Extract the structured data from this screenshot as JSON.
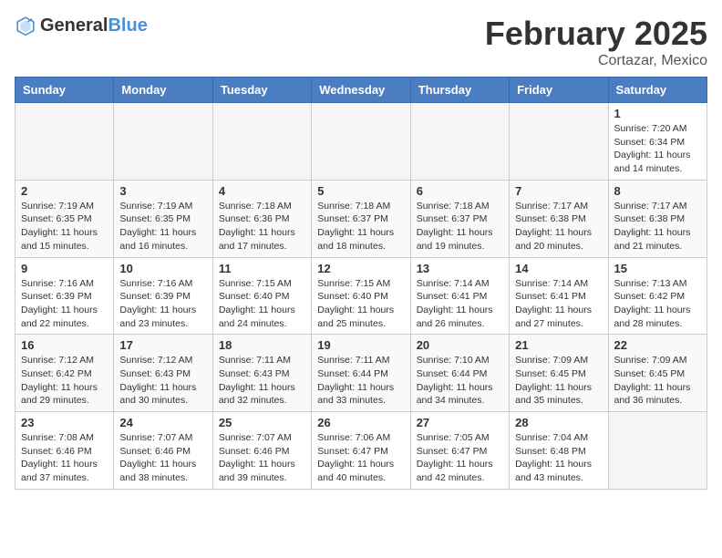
{
  "header": {
    "logo_general": "General",
    "logo_blue": "Blue",
    "month_year": "February 2025",
    "location": "Cortazar, Mexico"
  },
  "weekdays": [
    "Sunday",
    "Monday",
    "Tuesday",
    "Wednesday",
    "Thursday",
    "Friday",
    "Saturday"
  ],
  "weeks": [
    [
      {
        "day": "",
        "info": ""
      },
      {
        "day": "",
        "info": ""
      },
      {
        "day": "",
        "info": ""
      },
      {
        "day": "",
        "info": ""
      },
      {
        "day": "",
        "info": ""
      },
      {
        "day": "",
        "info": ""
      },
      {
        "day": "1",
        "info": "Sunrise: 7:20 AM\nSunset: 6:34 PM\nDaylight: 11 hours and 14 minutes."
      }
    ],
    [
      {
        "day": "2",
        "info": "Sunrise: 7:19 AM\nSunset: 6:35 PM\nDaylight: 11 hours and 15 minutes."
      },
      {
        "day": "3",
        "info": "Sunrise: 7:19 AM\nSunset: 6:35 PM\nDaylight: 11 hours and 16 minutes."
      },
      {
        "day": "4",
        "info": "Sunrise: 7:18 AM\nSunset: 6:36 PM\nDaylight: 11 hours and 17 minutes."
      },
      {
        "day": "5",
        "info": "Sunrise: 7:18 AM\nSunset: 6:37 PM\nDaylight: 11 hours and 18 minutes."
      },
      {
        "day": "6",
        "info": "Sunrise: 7:18 AM\nSunset: 6:37 PM\nDaylight: 11 hours and 19 minutes."
      },
      {
        "day": "7",
        "info": "Sunrise: 7:17 AM\nSunset: 6:38 PM\nDaylight: 11 hours and 20 minutes."
      },
      {
        "day": "8",
        "info": "Sunrise: 7:17 AM\nSunset: 6:38 PM\nDaylight: 11 hours and 21 minutes."
      }
    ],
    [
      {
        "day": "9",
        "info": "Sunrise: 7:16 AM\nSunset: 6:39 PM\nDaylight: 11 hours and 22 minutes."
      },
      {
        "day": "10",
        "info": "Sunrise: 7:16 AM\nSunset: 6:39 PM\nDaylight: 11 hours and 23 minutes."
      },
      {
        "day": "11",
        "info": "Sunrise: 7:15 AM\nSunset: 6:40 PM\nDaylight: 11 hours and 24 minutes."
      },
      {
        "day": "12",
        "info": "Sunrise: 7:15 AM\nSunset: 6:40 PM\nDaylight: 11 hours and 25 minutes."
      },
      {
        "day": "13",
        "info": "Sunrise: 7:14 AM\nSunset: 6:41 PM\nDaylight: 11 hours and 26 minutes."
      },
      {
        "day": "14",
        "info": "Sunrise: 7:14 AM\nSunset: 6:41 PM\nDaylight: 11 hours and 27 minutes."
      },
      {
        "day": "15",
        "info": "Sunrise: 7:13 AM\nSunset: 6:42 PM\nDaylight: 11 hours and 28 minutes."
      }
    ],
    [
      {
        "day": "16",
        "info": "Sunrise: 7:12 AM\nSunset: 6:42 PM\nDaylight: 11 hours and 29 minutes."
      },
      {
        "day": "17",
        "info": "Sunrise: 7:12 AM\nSunset: 6:43 PM\nDaylight: 11 hours and 30 minutes."
      },
      {
        "day": "18",
        "info": "Sunrise: 7:11 AM\nSunset: 6:43 PM\nDaylight: 11 hours and 32 minutes."
      },
      {
        "day": "19",
        "info": "Sunrise: 7:11 AM\nSunset: 6:44 PM\nDaylight: 11 hours and 33 minutes."
      },
      {
        "day": "20",
        "info": "Sunrise: 7:10 AM\nSunset: 6:44 PM\nDaylight: 11 hours and 34 minutes."
      },
      {
        "day": "21",
        "info": "Sunrise: 7:09 AM\nSunset: 6:45 PM\nDaylight: 11 hours and 35 minutes."
      },
      {
        "day": "22",
        "info": "Sunrise: 7:09 AM\nSunset: 6:45 PM\nDaylight: 11 hours and 36 minutes."
      }
    ],
    [
      {
        "day": "23",
        "info": "Sunrise: 7:08 AM\nSunset: 6:46 PM\nDaylight: 11 hours and 37 minutes."
      },
      {
        "day": "24",
        "info": "Sunrise: 7:07 AM\nSunset: 6:46 PM\nDaylight: 11 hours and 38 minutes."
      },
      {
        "day": "25",
        "info": "Sunrise: 7:07 AM\nSunset: 6:46 PM\nDaylight: 11 hours and 39 minutes."
      },
      {
        "day": "26",
        "info": "Sunrise: 7:06 AM\nSunset: 6:47 PM\nDaylight: 11 hours and 40 minutes."
      },
      {
        "day": "27",
        "info": "Sunrise: 7:05 AM\nSunset: 6:47 PM\nDaylight: 11 hours and 42 minutes."
      },
      {
        "day": "28",
        "info": "Sunrise: 7:04 AM\nSunset: 6:48 PM\nDaylight: 11 hours and 43 minutes."
      },
      {
        "day": "",
        "info": ""
      }
    ]
  ]
}
